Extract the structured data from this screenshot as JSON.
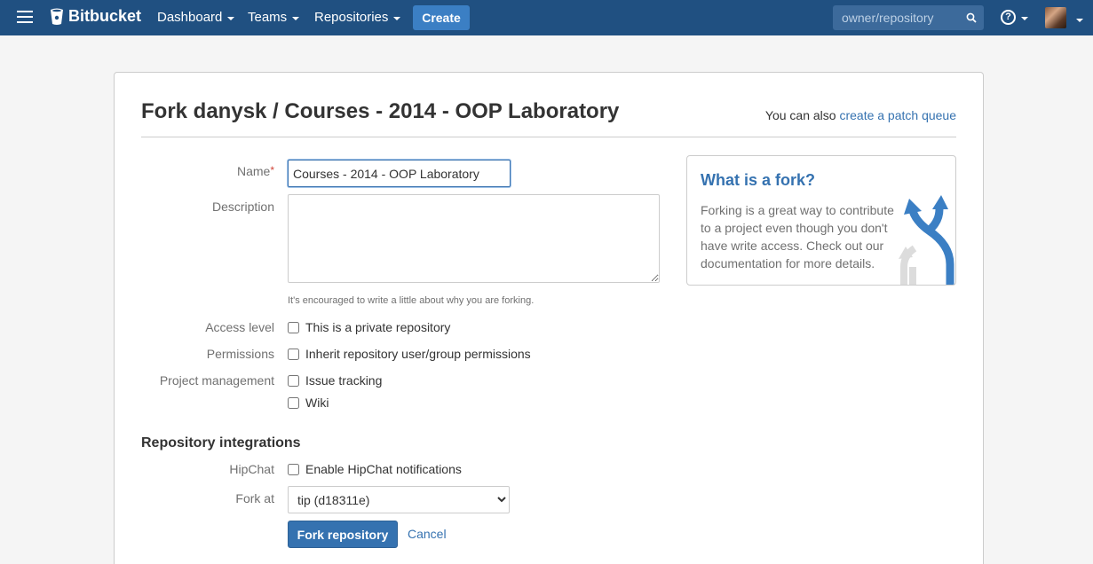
{
  "header": {
    "logo_text": "Bitbucket",
    "nav": [
      "Dashboard",
      "Teams",
      "Repositories"
    ],
    "create_label": "Create",
    "search_placeholder": "owner/repository",
    "help_symbol": "?"
  },
  "page": {
    "title": "Fork danysk / Courses - 2014 - OOP Laboratory",
    "patch_hint_prefix": "You can also",
    "patch_hint_link": "create a patch queue"
  },
  "form": {
    "name_label": "Name",
    "name_required_mark": "*",
    "name_value": "Courses - 2014 - OOP Laboratory",
    "description_label": "Description",
    "description_value": "",
    "description_help": "It's encouraged to write a little about why you are forking.",
    "access_label": "Access level",
    "access_option": "This is a private repository",
    "permissions_label": "Permissions",
    "permissions_option": "Inherit repository user/group permissions",
    "project_label": "Project management",
    "issue_tracking": "Issue tracking",
    "wiki": "Wiki",
    "integrations_heading": "Repository integrations",
    "hipchat_label": "HipChat",
    "hipchat_option": "Enable HipChat notifications",
    "fork_at_label": "Fork at",
    "fork_at_value": "tip (d18311e)",
    "submit_label": "Fork repository",
    "cancel_label": "Cancel"
  },
  "aside": {
    "title": "What is a fork?",
    "text": "Forking is a great way to contribute to a project even though you don't have write access. Check out our documentation for more details."
  },
  "colors": {
    "header_bg": "#205081",
    "primary": "#3572b0",
    "create_button": "#3b7fc4"
  }
}
